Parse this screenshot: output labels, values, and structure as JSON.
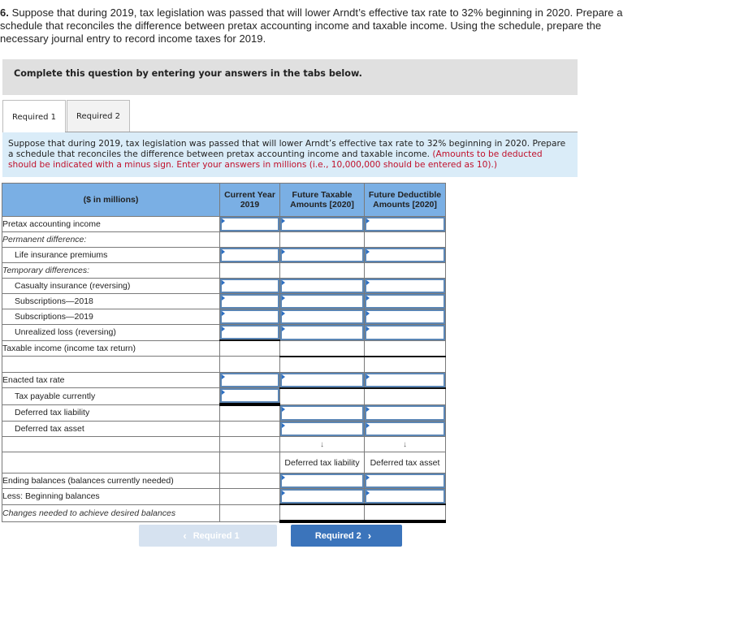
{
  "question": {
    "number": "6.",
    "text": "Suppose that during 2019, tax legislation was passed that will lower Arndt’s effective tax rate to 32% beginning in 2020. Prepare a schedule that reconciles the difference between pretax accounting income and taxable income. Using the schedule, prepare the necessary journal entry to record income taxes for 2019."
  },
  "instruction": "Complete this question by entering your answers in the tabs below.",
  "tabs": [
    {
      "label": "Required 1",
      "active": true
    },
    {
      "label": "Required 2",
      "active": false
    }
  ],
  "prompt": {
    "text": "Suppose that during 2019, tax legislation was passed that will lower Arndt’s effective tax rate to 32% beginning in 2020. Prepare a schedule that reconciles the difference between pretax accounting income and taxable income.",
    "note": "(Amounts to be deducted should be indicated with a minus sign. Enter your answers in millions (i.e., 10,000,000 should be entered as 10).)"
  },
  "table": {
    "headers": [
      "($ in millions)",
      "Current Year 2019",
      "Future Taxable Amounts [2020]",
      "Future Deductible Amounts [2020]"
    ],
    "rows": {
      "pretax": "Pretax accounting income",
      "permanent": "Permanent difference:",
      "life_ins": "Life insurance premiums",
      "temporary": "Temporary differences:",
      "casualty": "Casualty insurance (reversing)",
      "subs2018": "Subscriptions—2018",
      "subs2019": "Subscriptions—2019",
      "unrealized": "Unrealized loss (reversing)",
      "taxable": "Taxable income (income tax return)",
      "rate": "Enacted tax rate",
      "payable": "Tax payable currently",
      "dtl": "Deferred tax liability",
      "dta": "Deferred tax asset",
      "ending": "Ending balances (balances currently needed)",
      "beginning": "Less: Beginning balances",
      "changes": "Changes needed to achieve desired balances"
    },
    "arrow": "↓",
    "sub_headers": [
      "Deferred tax liability",
      "Deferred tax asset"
    ],
    "input_values": ""
  },
  "nav": {
    "prev_label": "Required 1",
    "prev_icon": "‹",
    "next_label": "Required 2",
    "next_icon": "›"
  }
}
